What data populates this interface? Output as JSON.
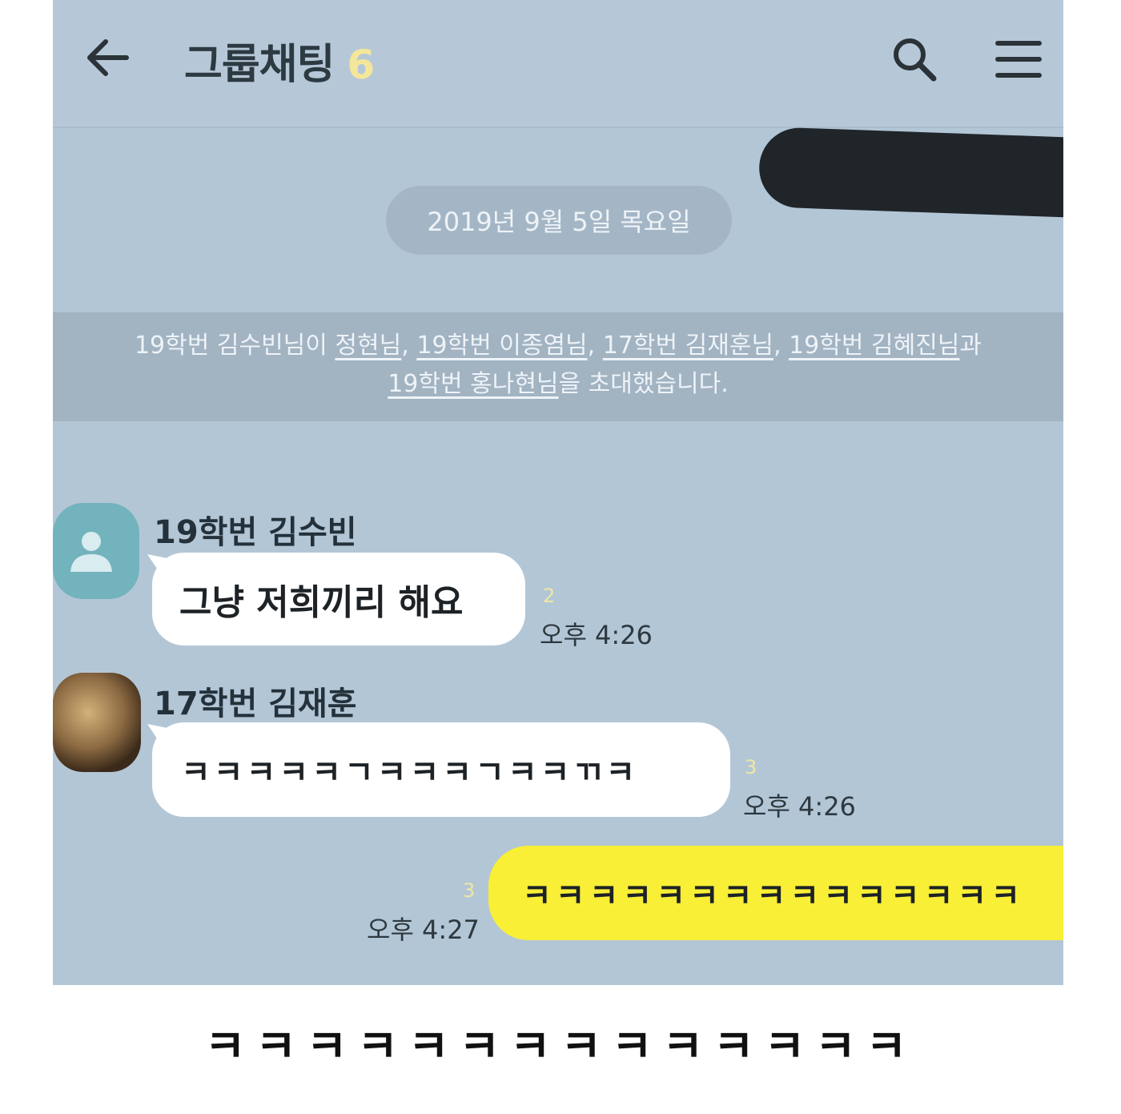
{
  "header": {
    "title": "그룹채팅",
    "member_count": "6"
  },
  "date_divider": "2019년 9월 5일 목요일",
  "notice": {
    "part1": "19학번 김수빈님이 ",
    "link1": "정현님",
    "sep1": ", ",
    "link2": "19학번 이종염님",
    "sep2": ", ",
    "link3": "17학번 김재훈님",
    "sep3": ", ",
    "link4": "19학번 김혜진님",
    "part2": "과 ",
    "link5": "19학번 홍나현님",
    "part3": "을 초대했습니다."
  },
  "messages": [
    {
      "sender": "19학번 김수빈",
      "text": "그냥 저희끼리 해요",
      "unread": "2",
      "time": "오후 4:26"
    },
    {
      "sender": "17학번 김재훈",
      "text": "ㅋㅋㅋㅋㅋㄱㅋㅋㅋㄱㅋㅋㄲㅋ",
      "unread": "3",
      "time": "오후 4:26"
    },
    {
      "text": "ㅋㅋㅋㅋㅋㅋㅋㅋㅋㅋㅋㅋㅋㅋㅋ",
      "unread": "3",
      "time": "오후 4:27"
    }
  ],
  "caption": "ㅋㅋㅋㅋㅋㅋㅋㅋㅋㅋㅋㅋㅋㅋ",
  "icons": [
    "back-arrow-icon",
    "search-icon",
    "menu-icon",
    "person-icon"
  ],
  "colors": {
    "chat_bg": "#b3c6d6",
    "my_bubble": "#f8ef36",
    "other_bubble": "#ffffff",
    "member_count": "#f4e79a"
  }
}
